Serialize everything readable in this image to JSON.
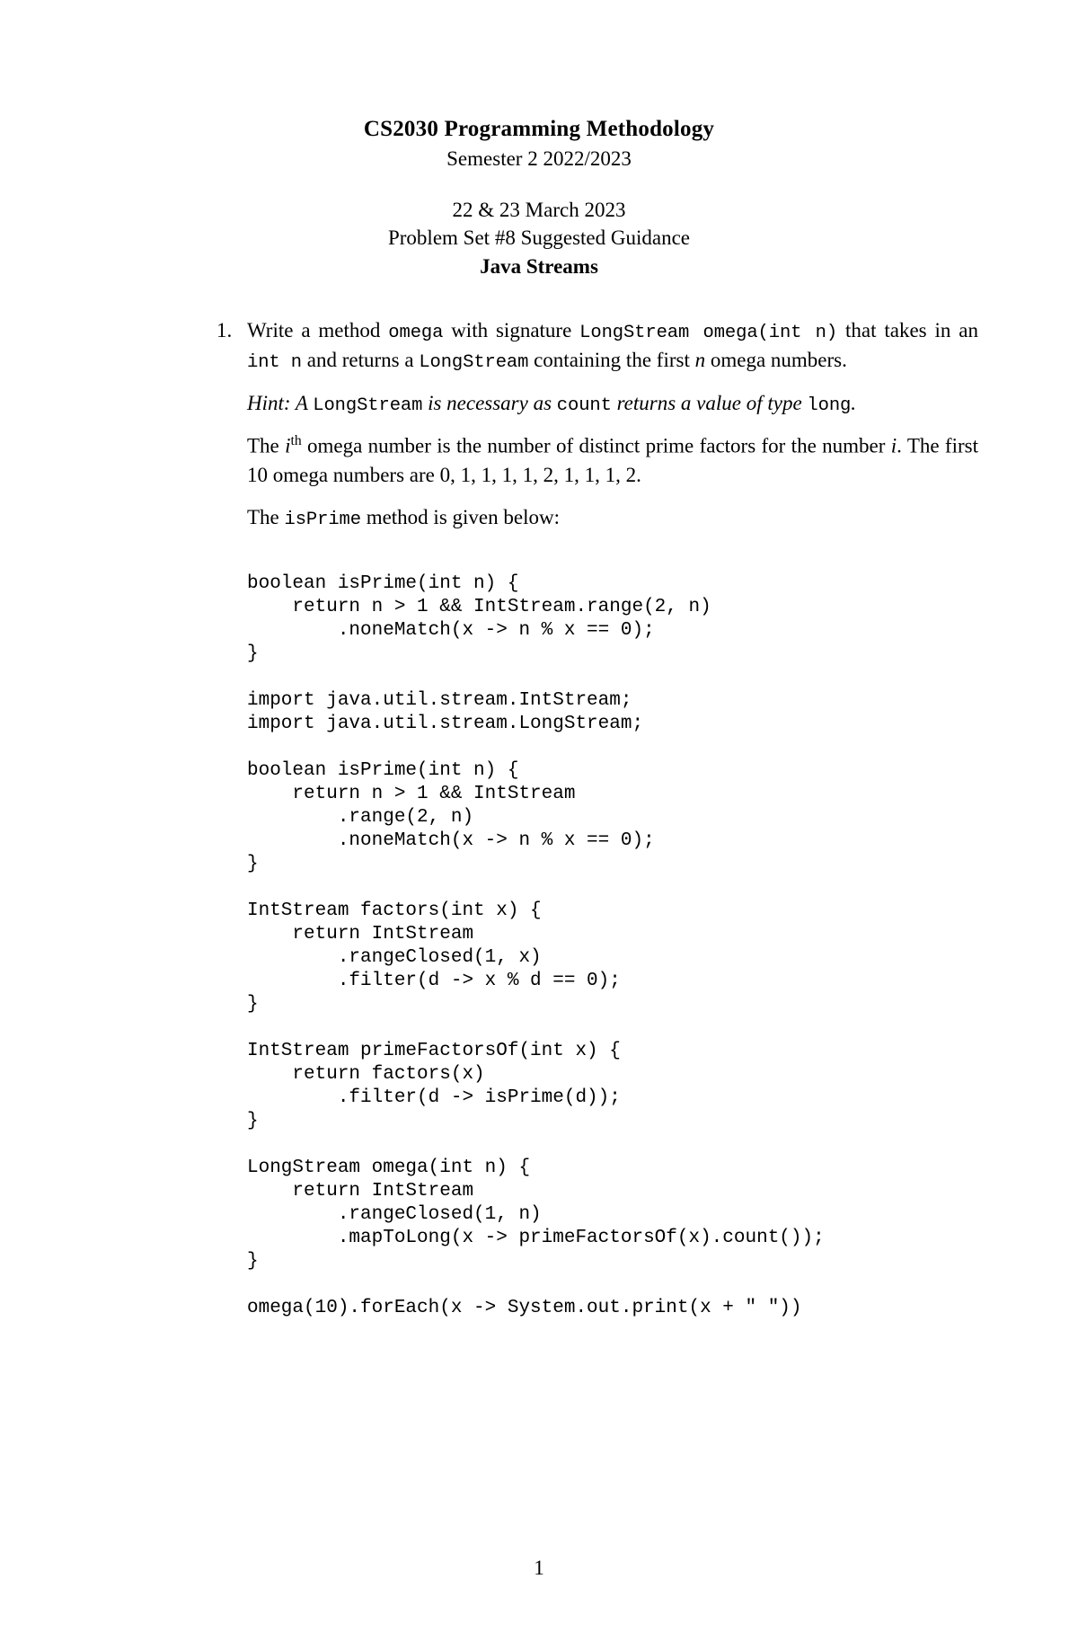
{
  "header": {
    "course_title": "CS2030 Programming Methodology",
    "semester": "Semester 2 2022/2023",
    "date": "22 & 23 March 2023",
    "problem_set": "Problem Set #8 Suggested Guidance",
    "topic": "Java Streams"
  },
  "problem": {
    "number": "1.",
    "statement": {
      "p1": "Write a method ",
      "code1": "omega",
      "p2": " with signature ",
      "code2": "LongStream omega(int n)",
      "p3": " that takes in an ",
      "code3": "int n",
      "p4": " and returns a ",
      "code4": "LongStream",
      "p5": " containing the first ",
      "var_n": "n",
      "p6": " omega numbers."
    },
    "hint": {
      "label": "Hint:",
      "t1": " A ",
      "code1": "LongStream",
      "t2": " is necessary as ",
      "code2": "count",
      "t3": " returns a value of type ",
      "code3": "long",
      "t4": "."
    },
    "definition": {
      "t1": "The ",
      "var_i": "i",
      "sup": "th",
      "t2": " omega number is the number of distinct prime factors for the number ",
      "var_i2": "i",
      "t3": ". The first 10 omega numbers are ",
      "sequence": "0, 1, 1, 1, 1, 2, 1, 1, 1, 2",
      "t4": "."
    },
    "given": {
      "t1": "The ",
      "code1": "isPrime",
      "t2": " method is given below:"
    }
  },
  "code_blocks": {
    "block1": "boolean isPrime(int n) {\n    return n > 1 && IntStream.range(2, n)\n        .noneMatch(x -> n % x == 0);\n}",
    "block2": "import java.util.stream.IntStream;\nimport java.util.stream.LongStream;",
    "block3": "boolean isPrime(int n) {\n    return n > 1 && IntStream\n        .range(2, n)\n        .noneMatch(x -> n % x == 0);\n}",
    "block4": "IntStream factors(int x) {\n    return IntStream\n        .rangeClosed(1, x)\n        .filter(d -> x % d == 0);\n}",
    "block5": "IntStream primeFactorsOf(int x) {\n    return factors(x)\n        .filter(d -> isPrime(d));\n}",
    "block6": "LongStream omega(int n) {\n    return IntStream\n        .rangeClosed(1, n)\n        .mapToLong(x -> primeFactorsOf(x).count());\n}",
    "block7": "omega(10).forEach(x -> System.out.print(x + \" \"))"
  },
  "footer": {
    "page_number": "1"
  }
}
